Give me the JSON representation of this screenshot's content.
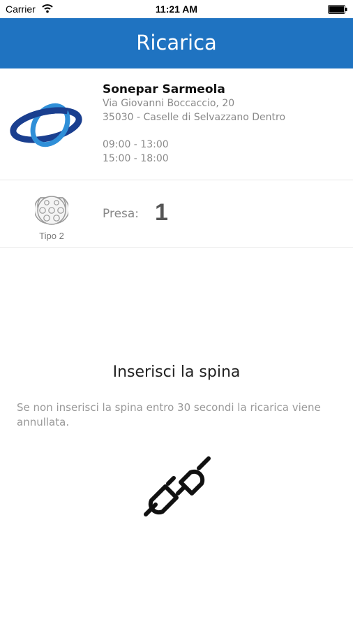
{
  "status_bar": {
    "carrier": "Carrier",
    "time": "11:21 AM"
  },
  "nav": {
    "title": "Ricarica"
  },
  "station": {
    "name": "Sonepar Sarmeola",
    "address_line1": "Via Giovanni Boccaccio, 20",
    "address_line2": "35030 - Caselle di Selvazzano Dentro",
    "hours_line1": "09:00 - 13:00",
    "hours_line2": "15:00 - 18:00",
    "logo_icon": "sonepar-logo",
    "logo_colors": [
      "#1a3f8f",
      "#2f8fd8"
    ]
  },
  "socket": {
    "icon": "type2-socket-icon",
    "type_label": "Tipo 2",
    "presa_label": "Presa:",
    "presa_value": "1"
  },
  "instructions": {
    "title": "Inserisci la spina",
    "text": "Se non inserisci la spina entro 30 secondi la ricarica viene annullata.",
    "icon": "plug-icon"
  },
  "colors": {
    "nav_background": "#1f73c1",
    "nav_text": "#ffffff"
  }
}
